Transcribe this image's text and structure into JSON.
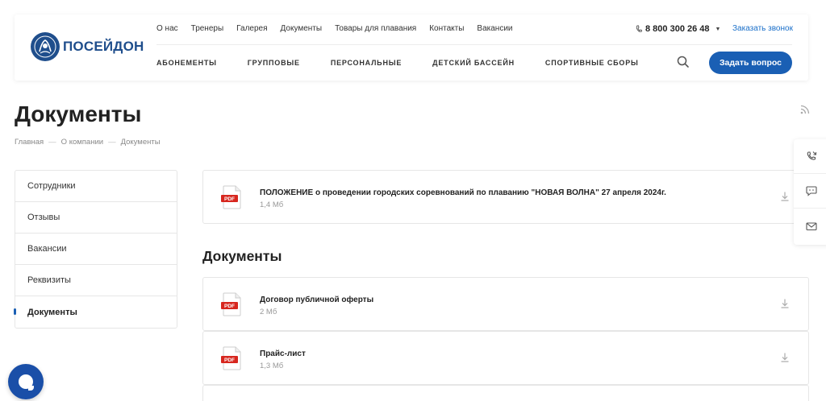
{
  "brand": {
    "name": "ПОСЕЙДОН",
    "color": "#1f4e8c"
  },
  "topnav": [
    "О нас",
    "Тренеры",
    "Галерея",
    "Документы",
    "Товары для плавания",
    "Контакты",
    "Вакансии"
  ],
  "phone": "8 800 300 26 48",
  "callback_label": "Заказать звонок",
  "mainnav": [
    "АБОНЕМЕНТЫ",
    "ГРУППОВЫЕ",
    "ПЕРСОНАЛЬНЫЕ",
    "ДЕТСКИЙ БАССЕЙН",
    "СПОРТИВНЫЕ СБОРЫ"
  ],
  "ask_button": "Задать вопрос",
  "accent": "#1a5fb4",
  "page_title": "Документы",
  "breadcrumb": [
    "Главная",
    "О компании",
    "Документы"
  ],
  "sidebar": [
    {
      "label": "Сотрудники"
    },
    {
      "label": "Отзывы"
    },
    {
      "label": "Вакансии"
    },
    {
      "label": "Реквизиты"
    },
    {
      "label": "Документы",
      "active": true
    }
  ],
  "featured_doc": {
    "title": "ПОЛОЖЕНИЕ о проведении городских соревнований по плаванию \"НОВАЯ ВОЛНА\" 27 апреля 2024г.",
    "size": "1,4 Мб",
    "icon_label": "PDF"
  },
  "section_heading": "Документы",
  "docs": [
    {
      "title": "Договор публичной оферты",
      "size": "2 Мб",
      "icon_label": "PDF"
    },
    {
      "title": "Прайс-лист",
      "size": "1,3 Мб",
      "icon_label": "PDF"
    }
  ]
}
